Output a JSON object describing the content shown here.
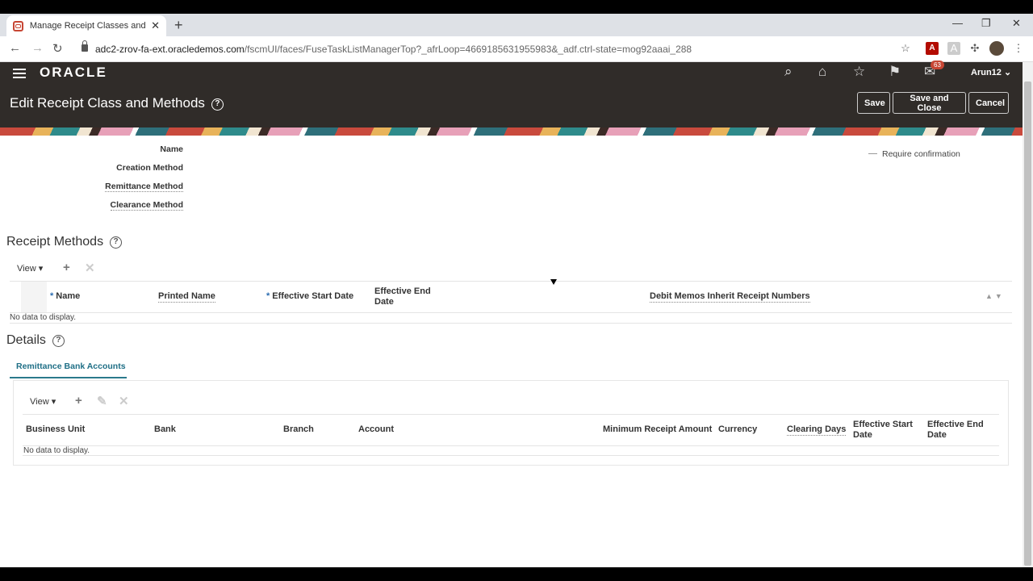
{
  "browser": {
    "tab_title": "Manage Receipt Classes and Methods",
    "url_host": "adc2-zrov-fa-ext.oracledemos.com",
    "url_path": "/fscmUI/faces/FuseTaskListManagerTop?_afrLoop=4669185631955983&_adf.ctrl-state=mog92aaai_288"
  },
  "header": {
    "logo": "ORACLE",
    "notification_count": "63",
    "user": "Arun12",
    "page_title": "Edit Receipt Class and Methods",
    "help_glyph": "?",
    "buttons": {
      "save": "Save",
      "save_close": "Save and Close",
      "cancel": "Cancel"
    }
  },
  "form": {
    "name_label": "Name",
    "creation_label": "Creation Method",
    "remittance_label": "Remittance Method",
    "clearance_label": "Clearance Method",
    "require_confirmation": "Require confirmation"
  },
  "receipt_methods": {
    "title": "Receipt Methods",
    "view_label": "View",
    "columns": [
      "Name",
      "Printed Name",
      "Effective Start Date",
      "Effective End Date",
      "Debit Memos Inherit Receipt Numbers"
    ],
    "empty": "No data to display."
  },
  "details": {
    "title": "Details",
    "tab": "Remittance Bank Accounts",
    "view_label": "View",
    "columns": [
      "Business Unit",
      "Bank",
      "Branch",
      "Account",
      "Minimum Receipt Amount",
      "Currency",
      "Clearing Days",
      "Effective Start Date",
      "Effective End Date"
    ],
    "empty": "No data to display."
  },
  "colors": {
    "header_bg": "#302c29",
    "accent": "#1f6f86",
    "oracle_red": "#c74634"
  }
}
